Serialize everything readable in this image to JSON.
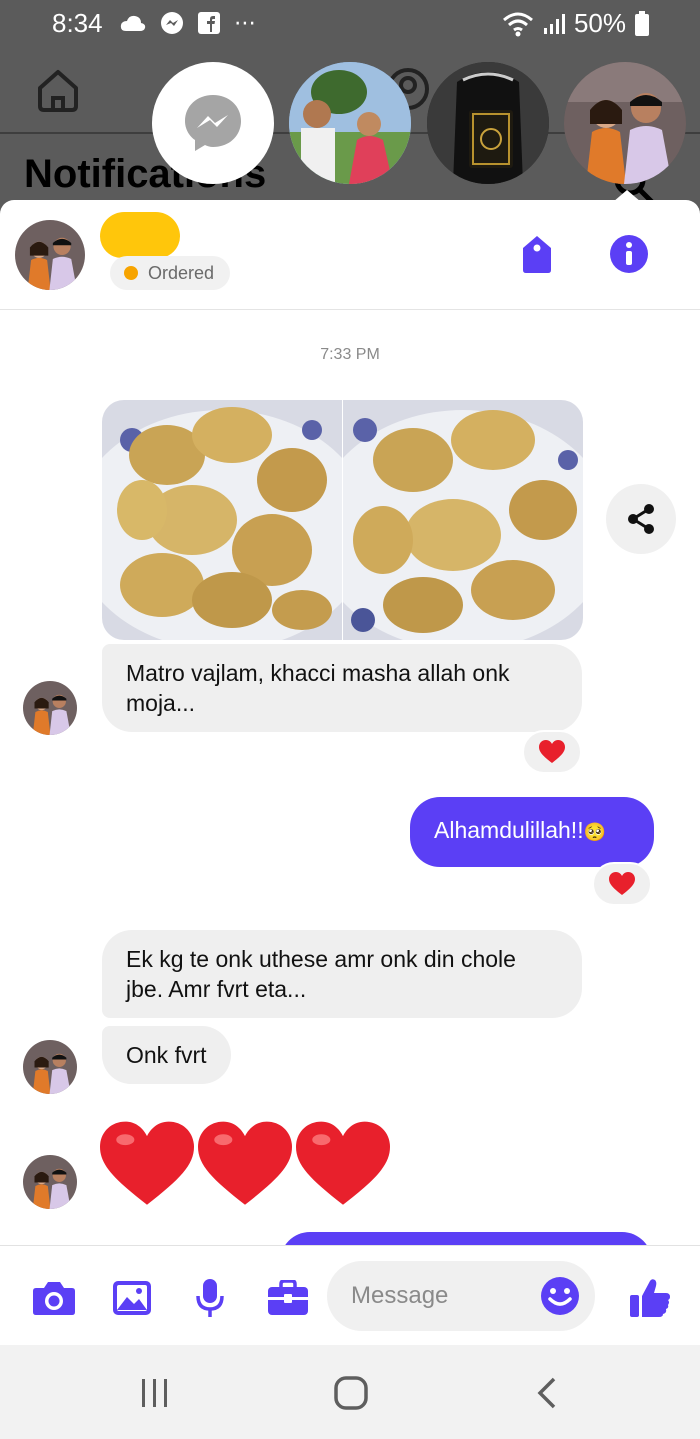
{
  "status_bar": {
    "time": "8:34",
    "battery": "50%",
    "more": "⋯"
  },
  "background_app": {
    "title": "Notifications"
  },
  "chat": {
    "label": "Ordered",
    "timestamp": "7:33 PM",
    "messages": [
      {
        "text": "Matro vajlam, khacci masha allah onk moja...",
        "reaction": "heart"
      },
      {
        "text": "Alhamdulillah!!",
        "emoji": "🥺",
        "reaction": "heart"
      },
      {
        "text": "Ek kg te onk uthese amr onk din chole jbe. Amr fvrt eta..."
      },
      {
        "text": "Onk fvrt"
      }
    ],
    "big_emoji": "hearts"
  },
  "composer": {
    "placeholder": "Message"
  },
  "colors": {
    "accent": "#5b3ff5",
    "heart": "#e8202c",
    "label_dot": "#f7a400"
  }
}
